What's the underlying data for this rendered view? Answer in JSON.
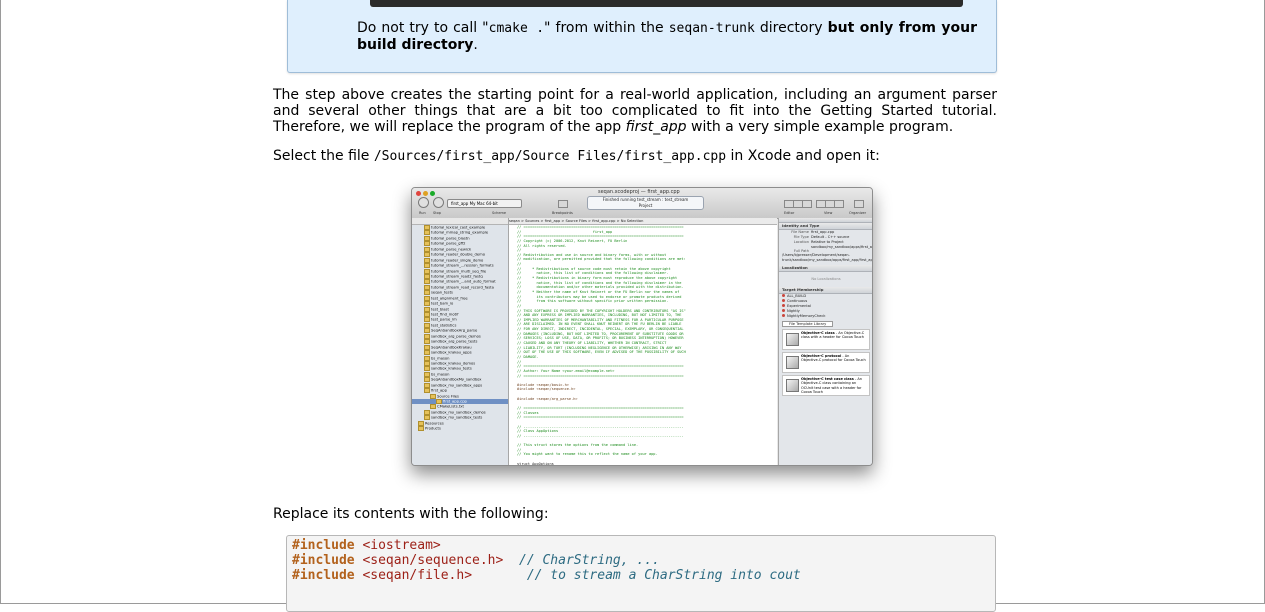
{
  "note": {
    "text_before": "Do not try to call \"",
    "code_cmake": "cmake .",
    "text_middle": "\" from within the ",
    "code_dir": "seqan-trunk",
    "text_after": " directory ",
    "bold_text": "but only from your build directory",
    "end": "."
  },
  "para1": {
    "text_before": "The step above creates the starting point for a real-world application, including an argument parser and several other things that are a bit too complicated to fit into the Getting Started tutorial. Therefore, we will replace the program of the app ",
    "italic": "first_app",
    "text_after": " with a very simple example program."
  },
  "para2": {
    "text_before": "Select the file ",
    "code": "/Sources/first_app/Source Files/first_app.cpp",
    "text_after": " in Xcode and open it:"
  },
  "screenshot": {
    "title": "seqan.xcodeproj — first_app.cpp",
    "status_line1": "Finished running test_stream : test_stream",
    "status_line2": "Project",
    "scheme": "first_app  My Mac 64-bit",
    "toolbar_labels": {
      "run": "Run",
      "stop": "Stop",
      "scheme": "Scheme",
      "breakpoints": "Breakpoints",
      "editor": "Editor",
      "view": "View",
      "organizer": "Organizer"
    },
    "jumpbar": "seqan  >  Sources  >  first_app  >  Source Files  >  first_app.cpp  >  No Selection",
    "navigator": [
      "tutorial_lexical_cast_example",
      "tutorial_mmap_string_example",
      "tutorial_parse_blastn",
      "tutorial_parse_gff2",
      "tutorial_parse_newick",
      "tutorial_reader_double_demo",
      "tutorial_reader_single_demo",
      "tutorial_stream_...ression_formats",
      "tutorial_stream_multi_seq_file",
      "tutorial_stream_read2_fastq",
      "tutorial_stream_...and_auto_format",
      "tutorial_stream_read_record_fasta",
      "seqan_tests",
      "test_alignment_free",
      "test_bam_io",
      "test_blast",
      "test_find_motif",
      "test_parse_lm",
      "test_statistics",
      "SeqAnSandboxArg_parse",
      "sandbox_arg_parse_demos",
      "sandbox_arg_parse_tests",
      "SeqAnSandboxKrakau",
      "sandbox_krakau_apps",
      "bs_mason",
      "sandbox_krakau_demos",
      "sandbox_krakau_tests",
      "bs_mason",
      "SeqAnSandboxMy_sandbox",
      "sandbox_my_sandbox_apps",
      "first_app",
      "Source Files",
      "first_app.cpp",
      "CMakeLists.txt",
      "sandbox_my_sandbox_demos",
      "sandbox_my_sandbox_tests",
      "Resources",
      "Products"
    ],
    "code_lines": [
      "// ==========================================================================",
      "//                                 first_app",
      "// ==========================================================================",
      "// Copyright (c) 2006-2012, Knut Reinert, FU Berlin",
      "// All rights reserved.",
      "//",
      "// Redistribution and use in source and binary forms, with or without",
      "// modification, are permitted provided that the following conditions are met:",
      "//",
      "//     * Redistributions of source code must retain the above copyright",
      "//       notice, this list of conditions and the following disclaimer.",
      "//     * Redistributions in binary form must reproduce the above copyright",
      "//       notice, this list of conditions and the following disclaimer in the",
      "//       documentation and/or other materials provided with the distribution.",
      "//     * Neither the name of Knut Reinert or the FU Berlin nor the names of",
      "//       its contributors may be used to endorse or promote products derived",
      "//       from this software without specific prior written permission.",
      "//",
      "// THIS SOFTWARE IS PROVIDED BY THE COPYRIGHT HOLDERS AND CONTRIBUTORS \"AS IS\"",
      "// AND ANY EXPRESS OR IMPLIED WARRANTIES, INCLUDING, BUT NOT LIMITED TO, THE",
      "// IMPLIED WARRANTIES OF MERCHANTABILITY AND FITNESS FOR A PARTICULAR PURPOSE",
      "// ARE DISCLAIMED. IN NO EVENT SHALL KNUT REINERT OR THE FU BERLIN BE LIABLE",
      "// FOR ANY DIRECT, INDIRECT, INCIDENTAL, SPECIAL, EXEMPLARY, OR CONSEQUENTIAL",
      "// DAMAGES (INCLUDING, BUT NOT LIMITED TO, PROCUREMENT OF SUBSTITUTE GOODS OR",
      "// SERVICES; LOSS OF USE, DATA, OR PROFITS; OR BUSINESS INTERRUPTION) HOWEVER",
      "// CAUSED AND ON ANY THEORY OF LIABILITY, WHETHER IN CONTRACT, STRICT",
      "// LIABILITY, OR TORT (INCLUDING NEGLIGENCE OR OTHERWISE) ARISING IN ANY WAY",
      "// OUT OF THE USE OF THIS SOFTWARE, EVEN IF ADVISED OF THE POSSIBILITY OF SUCH",
      "// DAMAGE.",
      "//",
      "// ==========================================================================",
      "// Author: Your Name <your.email@example.net>",
      "// ==========================================================================",
      "",
      "#include <seqan/basic.h>",
      "#include <seqan/sequence.h>",
      "",
      "#include <seqan/arg_parse.h>",
      "",
      "// ==========================================================================",
      "// Classes",
      "// ==========================================================================",
      "",
      "// --------------------------------------------------------------------------",
      "// Class AppOptions",
      "// --------------------------------------------------------------------------",
      "",
      "// This struct stores the options from the command line.",
      "//",
      "// You might want to rename this to reflect the name of your app.",
      "",
      "struct AppOptions"
    ],
    "utility": {
      "identity_header": "Identity and Type",
      "file_name_label": "File Name",
      "file_name": "first_app.cpp",
      "file_type_label": "File Type",
      "file_type": "Default - C++ source",
      "location_label": "Location",
      "location": "Relative to Project",
      "location_path": "sandbox/my_sandbox/apps/first_app/first_app.cpp",
      "full_path_label": "Full Path",
      "full_path": "/Users/bjpresser/Development/seqan-trunk/sandbox/my_sandbox/apps/first_app/first_app.cpp",
      "localization_header": "Localization",
      "no_localizations": "No Localizations",
      "target_header": "Target Membership",
      "targets": [
        "ALL_BUILD",
        "Continuous",
        "Experimental",
        "Nightly",
        "NightlyMemoryCheck"
      ],
      "library_select": "File Template Library",
      "library_items": [
        {
          "title": "Objective-C class",
          "desc": "An Objective-C class with a header for Cocoa Touch"
        },
        {
          "title": "Objective-C protocol",
          "desc": "An Objective-C protocol for Cocoa Touch"
        },
        {
          "title": "Objective-C test case class",
          "desc": "An Objective-C class containing an OCUnit test case with a header for Cocoa Touch"
        }
      ]
    }
  },
  "para3": {
    "text": "Replace its contents with the following:"
  },
  "code_block": {
    "lines": [
      {
        "pp": "#include",
        "path": " <iostream>",
        "comment": ""
      },
      {
        "pp": "#include",
        "path": " <seqan/sequence.h>",
        "comment": "  // CharString, ..."
      },
      {
        "pp": "#include",
        "path": " <seqan/file.h>",
        "comment": "       // to stream a CharString into cout"
      }
    ]
  }
}
